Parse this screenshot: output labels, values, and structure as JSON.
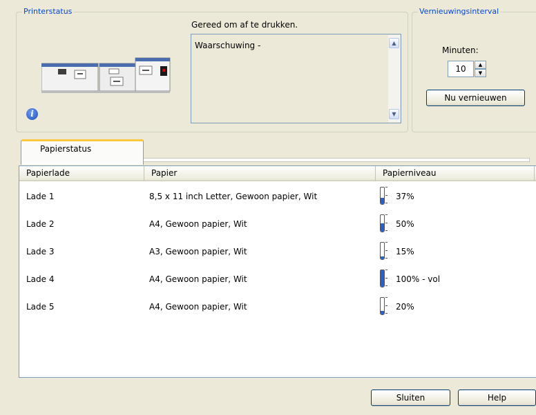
{
  "printer_status": {
    "legend": "Printerstatus",
    "status_text": "Gereed om af te drukken.",
    "messages": "Waarschuwing -",
    "info_icon": "info-icon",
    "printer_icon": "printer-image"
  },
  "refresh": {
    "legend": "Vernieuwingsinterval",
    "minutes_label": "Minuten:",
    "minutes_value": "10",
    "refresh_button": "Nu vernieuwen"
  },
  "tabs": [
    {
      "label": "Papierstatus",
      "active": true
    }
  ],
  "table": {
    "columns": [
      "Papierlade",
      "Papier",
      "Papierniveau"
    ],
    "rows": [
      {
        "tray": "Lade 1",
        "paper": "8,5 x 11 inch Letter, Gewoon papier, Wit",
        "level": 0.37,
        "level_text": "37%"
      },
      {
        "tray": "Lade 2",
        "paper": "A4, Gewoon papier, Wit",
        "level": 0.5,
        "level_text": "50%"
      },
      {
        "tray": "Lade 3",
        "paper": "A3, Gewoon papier, Wit",
        "level": 0.15,
        "level_text": "15%"
      },
      {
        "tray": "Lade 4",
        "paper": "A4, Gewoon papier, Wit",
        "level": 1.0,
        "level_text": "100% - vol"
      },
      {
        "tray": "Lade 5",
        "paper": "A4, Gewoon papier, Wit",
        "level": 0.2,
        "level_text": "20%"
      }
    ]
  },
  "footer": {
    "close_button": "Sluiten",
    "help_button": "Help"
  },
  "colors": {
    "accent_tab": "#ffc83c",
    "legend_text": "#0046d5",
    "gauge_fill": "#2a5fd0",
    "window_bg": "#ece9d8"
  }
}
